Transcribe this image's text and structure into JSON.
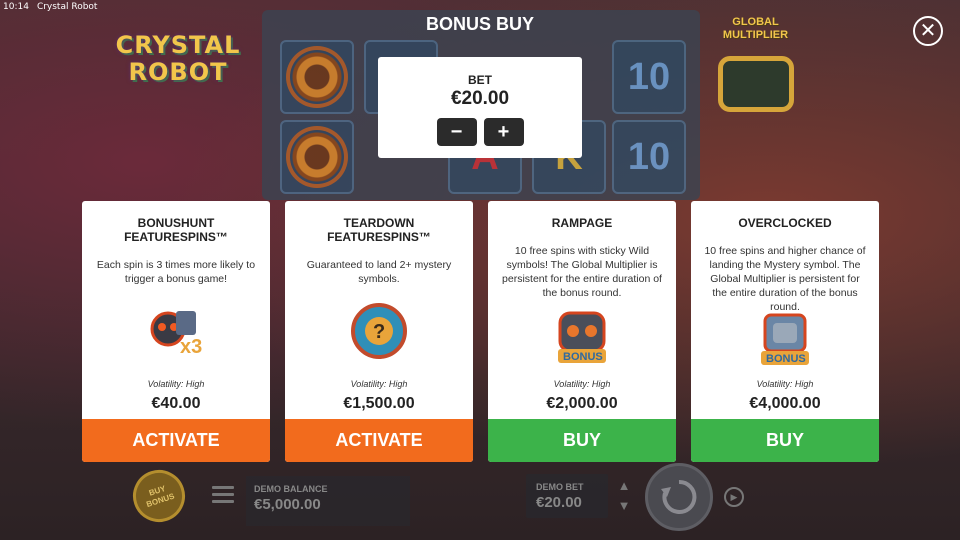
{
  "window": {
    "time": "10:14",
    "app_title": "Crystal Robot"
  },
  "logo": {
    "line1": "CRYSTAL",
    "line2": "ROBOT"
  },
  "global_multiplier": {
    "label": "GLOBAL MULTIPLIER"
  },
  "reels": {
    "ten_symbol": "10",
    "k_symbol": "K",
    "a_symbol": "A"
  },
  "modal": {
    "title": "BONUS BUY",
    "close_icon": "close-icon",
    "bet": {
      "label": "BET",
      "value": "€20.00",
      "decrease": "−",
      "increase": "+"
    },
    "cards": [
      {
        "title": "BONUSHUNT FEATURESPINS™",
        "description": "Each spin is 3 times more likely to trigger a bonus game!",
        "volatility": "Volatility: High",
        "price": "€40.00",
        "action": "ACTIVATE",
        "action_color": "#f26b1d",
        "icon": "bonus-x3-icon"
      },
      {
        "title": "TEARDOWN FEATURESPINS™",
        "description": "Guaranteed to land 2+ mystery symbols.",
        "volatility": "Volatility: High",
        "price": "€1,500.00",
        "action": "ACTIVATE",
        "action_color": "#f26b1d",
        "icon": "mystery-gear-icon"
      },
      {
        "title": "RAMPAGE",
        "description": "10 free spins with sticky Wild symbols! The Global Multiplier is persistent for the entire duration of the bonus round.",
        "volatility": "Volatility: High",
        "price": "€2,000.00",
        "action": "BUY",
        "action_color": "#3cb34a",
        "icon": "robot-bonus-icon"
      },
      {
        "title": "OVERCLOCKED",
        "description": "10 free spins and higher chance of landing the Mystery symbol. The Global Multiplier is persistent for the entire duration of the bonus round.",
        "volatility": "Volatility: High",
        "price": "€4,000.00",
        "action": "BUY",
        "action_color": "#3cb34a",
        "icon": "fist-bonus-icon"
      }
    ]
  },
  "bottom_bar": {
    "buy_bonus_label": "BUY BONUS",
    "balance_label": "DEMO BALANCE",
    "balance_value": "€5,000.00",
    "bet_label": "DEMO BET",
    "bet_value": "€20.00",
    "autoplay_icon": "autoplay-icon",
    "spin_icon": "spin-icon"
  }
}
